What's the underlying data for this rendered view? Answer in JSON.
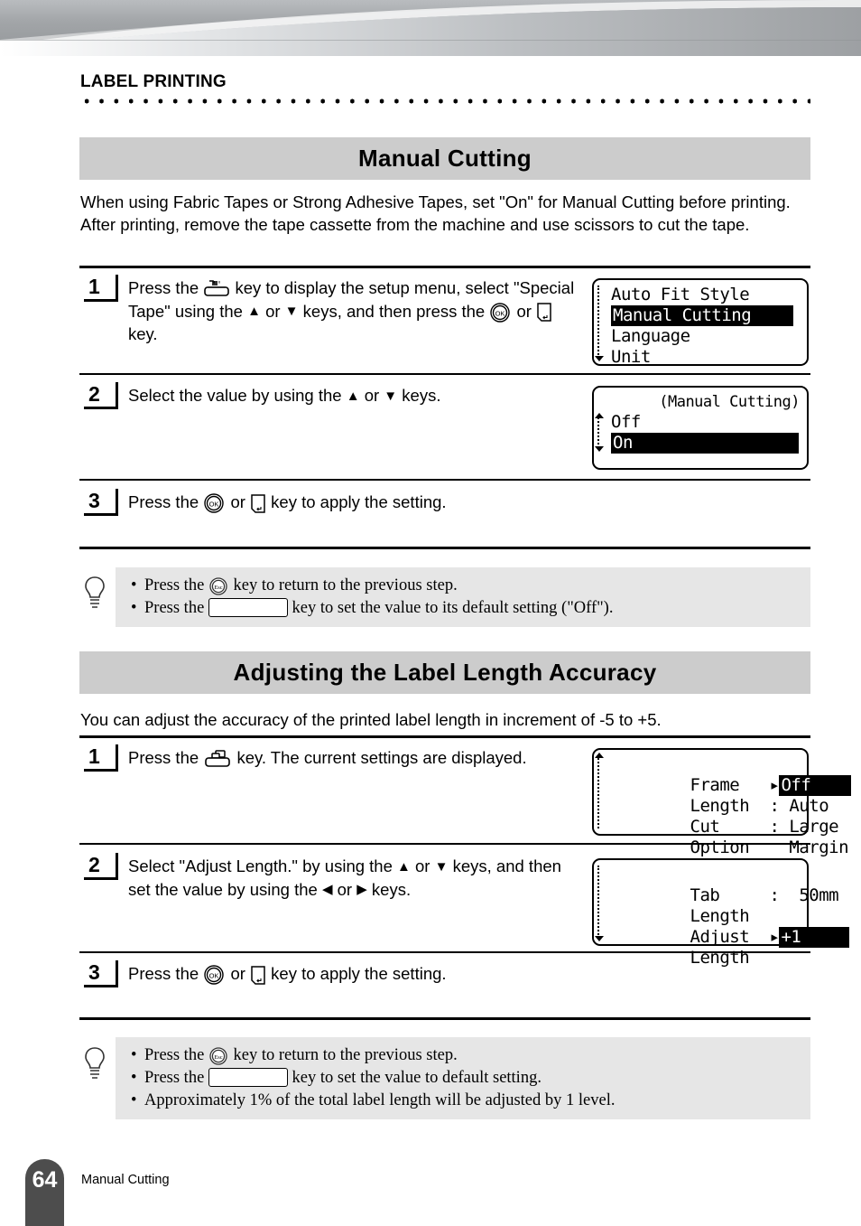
{
  "chapter": "LABEL PRINTING",
  "sections": [
    {
      "title": "Manual Cutting",
      "intro": "When using Fabric Tapes or Strong Adhesive Tapes, set \"On\" for Manual Cutting before printing. After printing, remove the tape cassette from the machine and use scissors to cut the tape.",
      "steps": [
        {
          "number": "1",
          "text_a": "Press the",
          "text_b": "key to display the setup menu, select \"Special Tape\" using the",
          "text_c": "or",
          "text_d": "keys, and then press the",
          "text_e": "or",
          "text_f": "key."
        },
        {
          "number": "2",
          "text_a": "Select the value by using the",
          "text_b": "or",
          "text_c": "keys."
        },
        {
          "number": "3",
          "text_a": "Press the",
          "text_b": "or",
          "text_c": "key to apply the setting."
        }
      ],
      "screens": [
        {
          "title": "",
          "rows": [
            {
              "label": "Auto Fit Style",
              "value": "",
              "highlight": false
            },
            {
              "label": "Manual Cutting",
              "value": "",
              "highlight": true
            },
            {
              "label": "Language",
              "value": "",
              "highlight": false
            },
            {
              "label": "Unit",
              "value": "",
              "highlight": false
            }
          ]
        },
        {
          "title": "(Manual Cutting)",
          "rows": [
            {
              "label": "Off",
              "value": "",
              "highlight": false
            },
            {
              "label": "On",
              "value": "",
              "highlight": true
            }
          ]
        }
      ],
      "tips": [
        "Press the  key to return to the previous step.",
        "Press the  key to set the value to its default setting (\"Off\")."
      ],
      "tip_lines": [
        {
          "pre": "Press the",
          "icon": "esc-key",
          "post": "key to return to the previous step."
        },
        {
          "pre": "Press the",
          "icon": "blank-key",
          "post": "key to set the value to its default setting (\"Off\")."
        }
      ]
    },
    {
      "title": "Adjusting the Label Length Accuracy",
      "intro": "You can adjust the accuracy of the printed label length in increment of -5 to +5.",
      "steps": [
        {
          "number": "1",
          "text_a": "Press the",
          "text_b": "key. The current settings are displayed."
        },
        {
          "number": "2",
          "text_a": "Select \"Adjust Length.\" by using the",
          "text_b": "or",
          "text_c": "keys, and then set the value by using the",
          "text_d": "or",
          "text_e": "keys."
        },
        {
          "number": "3",
          "text_a": "Press the",
          "text_b": "or",
          "text_c": "key to apply the setting."
        }
      ],
      "screens": [
        {
          "title": "",
          "rows": [
            {
              "label": "Frame",
              "sep": "▸",
              "value": "Off",
              "highlight": true
            },
            {
              "label": "Length",
              "sep": ":",
              "value": "Auto",
              "highlight": false
            },
            {
              "label": "Cut",
              "sep": ":",
              "value": "Large",
              "highlight": false
            },
            {
              "label": "Option",
              "sep": " ",
              "value": "Margin",
              "highlight": false
            }
          ]
        },
        {
          "title": "",
          "rows": [
            {
              "label": "Tab",
              "sep": ":",
              "value": "50mm",
              "highlight": false
            },
            {
              "label": "Length",
              "sep": "",
              "value": "",
              "highlight": false
            },
            {
              "label": "Adjust",
              "sep": "▸",
              "value": "+1",
              "highlight": true
            },
            {
              "label": "Length",
              "sep": "",
              "value": "",
              "highlight": false
            }
          ]
        }
      ],
      "tip_lines": [
        {
          "pre": "Press the",
          "icon": "esc-key",
          "post": "key to return to the previous step."
        },
        {
          "pre": "Press the",
          "icon": "blank-key",
          "post": "key to set the value to default setting."
        },
        {
          "pre": "",
          "icon": "",
          "post": "Approximately 1% of the total label length will be adjusted by 1 level."
        }
      ]
    }
  ],
  "icons": {
    "up_arrow": "▲",
    "down_arrow": "▼",
    "left_arrow": "◀",
    "right_arrow": "▶",
    "ok_label": "OK",
    "esc_label": "Esc"
  },
  "footer": {
    "page_number": "64",
    "running_title": "Manual Cutting"
  },
  "colors": {
    "section_bar": "#cccccc",
    "tip_bg": "#e6e6e6",
    "page_tab": "#4d4d4d",
    "banner_dark": "#a0a3a6",
    "banner_light": "#e9eaec"
  }
}
